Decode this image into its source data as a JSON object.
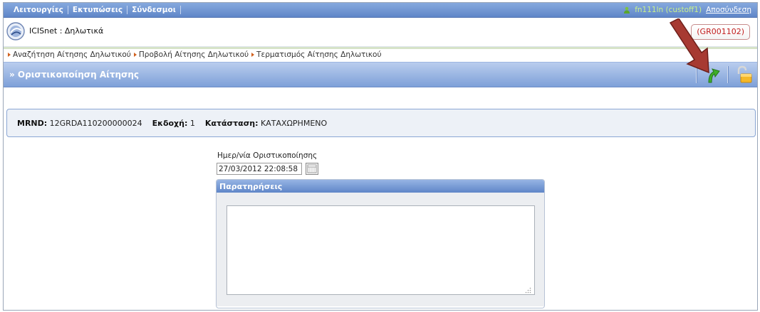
{
  "topbar": {
    "menu": [
      "Λειτουργίες",
      "Εκτυπώσεις",
      "Σύνδεσμοι"
    ],
    "user": "fn111ln (custoff1)",
    "logout": "Αποσύνδεση"
  },
  "app": {
    "title": "ICISnet : Δηλωτικά",
    "code": "(GR001102)"
  },
  "breadcrumbs": [
    "Αναζήτηση Αίτησης Δηλωτικού",
    "Προβολή Αίτησης Δηλωτικού",
    "Τερματισμός Αίτησης Δηλωτικού"
  ],
  "section": {
    "title": "» Οριστικοποίηση Αίτησης"
  },
  "info": {
    "mrnd_label": "MRND:",
    "mrnd_value": "12GRDA110200000024",
    "version_label": "Εκδοχή:",
    "version_value": "1",
    "status_label": "Κατάσταση:",
    "status_value": "ΚΑΤΑΧΩΡΗΜΕΝΟ"
  },
  "form": {
    "date_label": "Ημερ/νία Οριστικοποίησης",
    "date_value": "27/03/2012 22:08:58",
    "remarks_title": "Παρατηρήσεις",
    "remarks_value": ""
  },
  "icons": {
    "user": "user-icon",
    "logo": "icisnet-logo-icon",
    "confirm": "green-up-arrow-icon",
    "unlock": "unlock-icon",
    "calendar": "calendar-icon",
    "annotation": "red-pointer-arrow-icon"
  },
  "colors": {
    "menu_bar": "#5f86c8",
    "username": "#c9f08b",
    "code_text": "#c22020",
    "crumb_arrow": "#d0611f",
    "annotation_arrow": "#b0322a"
  }
}
